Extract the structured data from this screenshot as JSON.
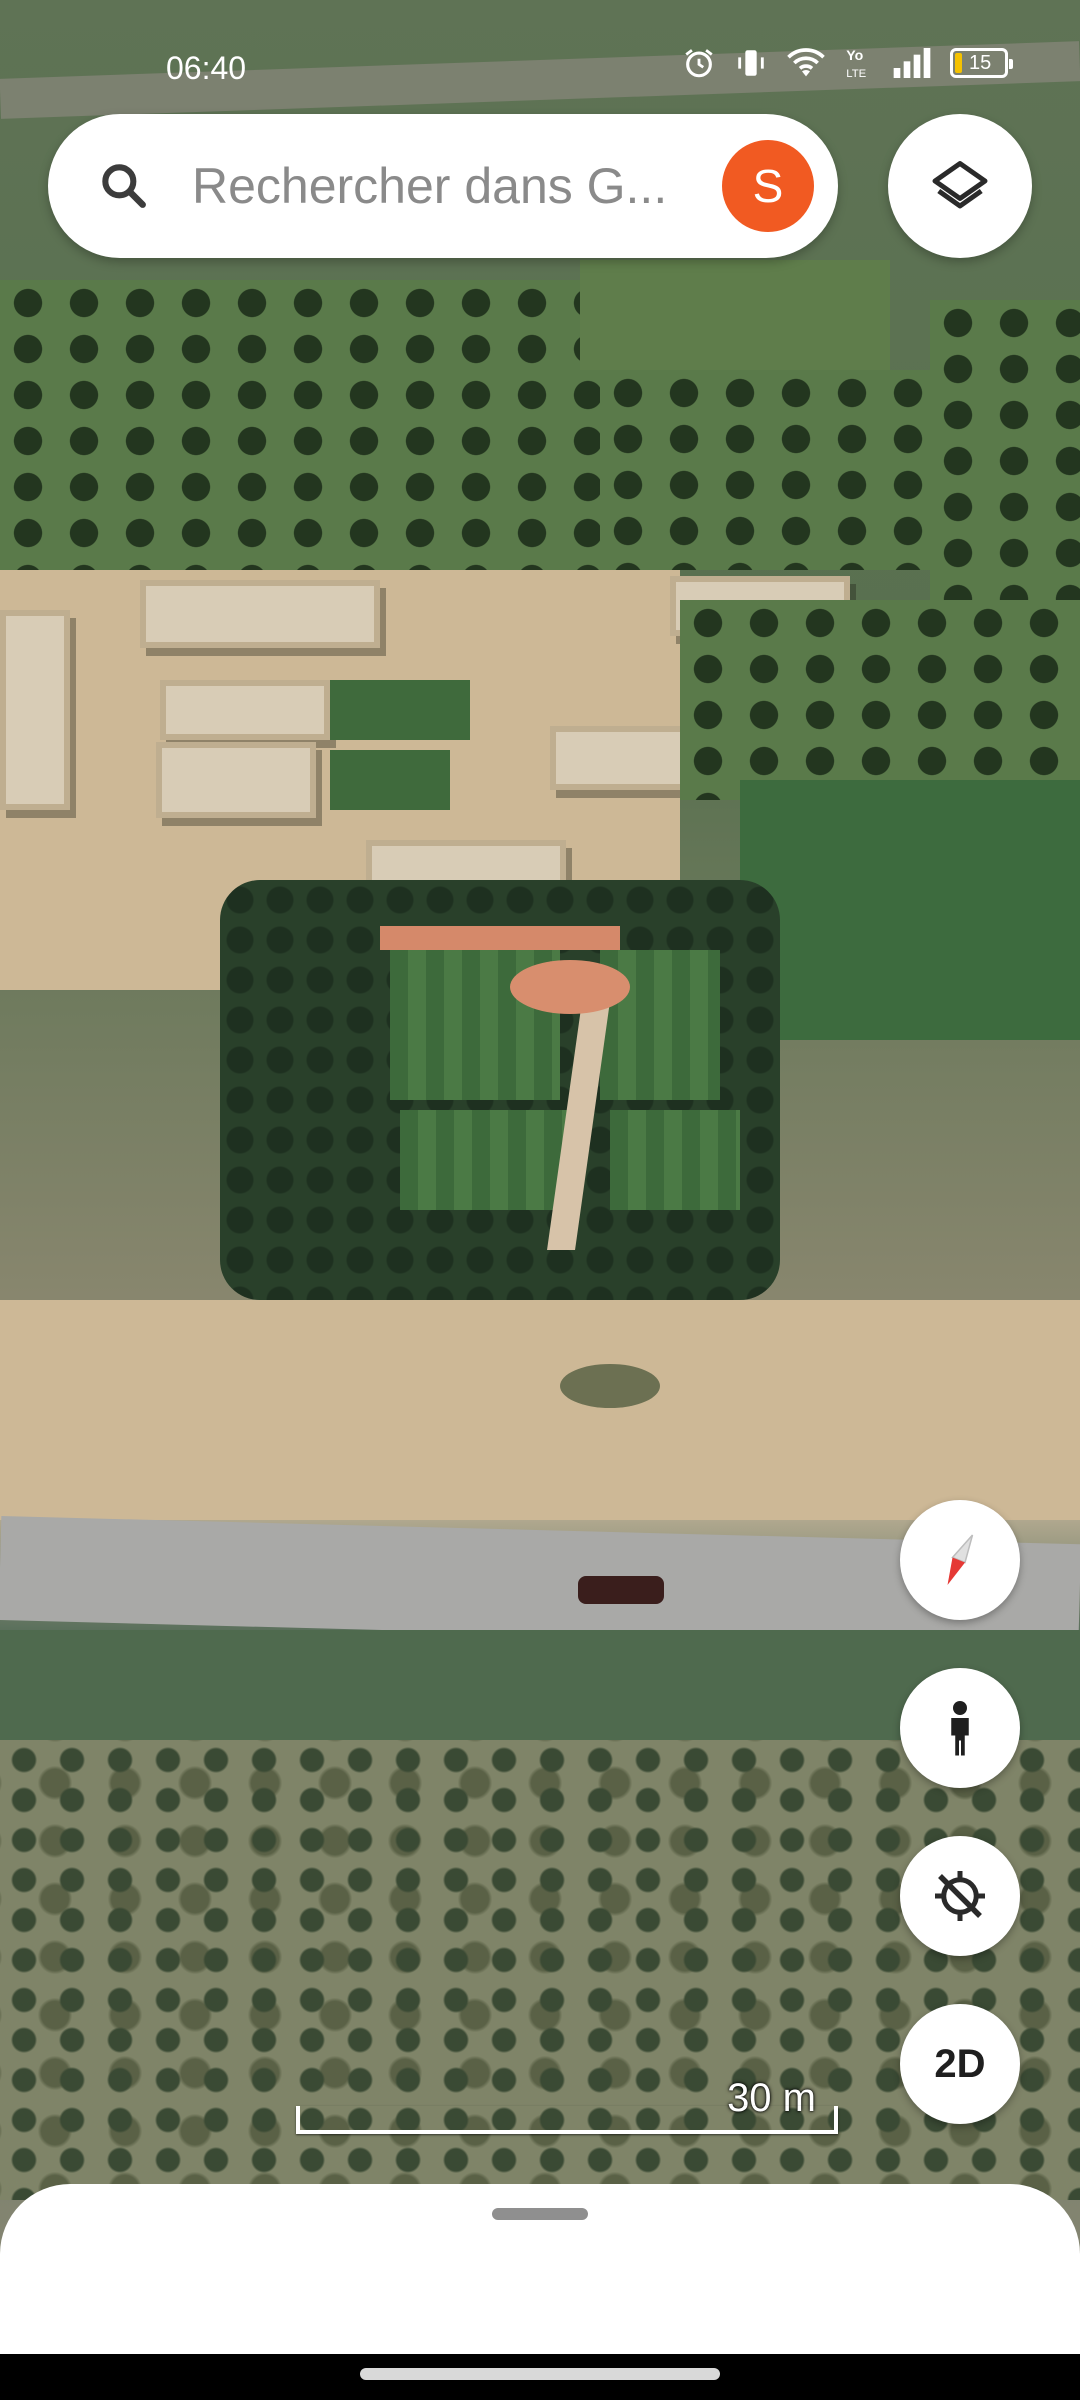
{
  "status_bar": {
    "time": "06:40",
    "icons": [
      "alarm-icon",
      "vibrate-icon",
      "wifi-icon",
      "volte-icon",
      "signal-icon",
      "battery-icon"
    ],
    "battery_level": "15",
    "battery_fraction": 0.15
  },
  "search": {
    "placeholder": "Rechercher dans G...",
    "avatar_initial": "S",
    "avatar_color": "#f15a22"
  },
  "map_controls": {
    "layers": "layers-icon",
    "compass": "compass-icon",
    "street_view": "pegman-icon",
    "location": "my-location-off-icon",
    "view_mode_label": "2D"
  },
  "scale": {
    "label": "30 m"
  },
  "colors": {
    "accent": "#f15a22",
    "compass_red": "#e53935"
  }
}
